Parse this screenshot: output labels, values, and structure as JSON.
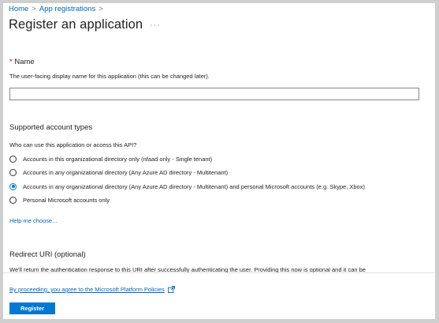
{
  "breadcrumb": {
    "items": [
      "Home",
      "App registrations"
    ],
    "separator": ">"
  },
  "page": {
    "title": "Register an application",
    "more_label": "···"
  },
  "name_section": {
    "required_mark": "*",
    "label": "Name",
    "description": "The user-facing display name for this application (this can be changed later).",
    "value": ""
  },
  "account_types": {
    "title": "Supported account types",
    "question": "Who can use this application or access this API?",
    "options": [
      "Accounts in this organizational directory only (nfaad only - Single tenant)",
      "Accounts in any organizational directory (Any Azure AD directory - Multitenant)",
      "Accounts in any organizational directory (Any Azure AD directory - Multitenant) and personal Microsoft accounts (e.g. Skype, Xbox)",
      "Personal Microsoft accounts only"
    ],
    "selected_index": 2,
    "help_link": "Help me choose..."
  },
  "redirect": {
    "title": "Redirect URI (optional)",
    "description": "We'll return the authentication response to this URI after successfully authenticating the user. Providing this now is optional and it can be"
  },
  "footer": {
    "policy_text": "By proceeding, you agree to the Microsoft Platform Policies",
    "register_label": "Register"
  },
  "colors": {
    "accent": "#0078d4",
    "link": "#0066b8",
    "required": "#a4262c"
  }
}
